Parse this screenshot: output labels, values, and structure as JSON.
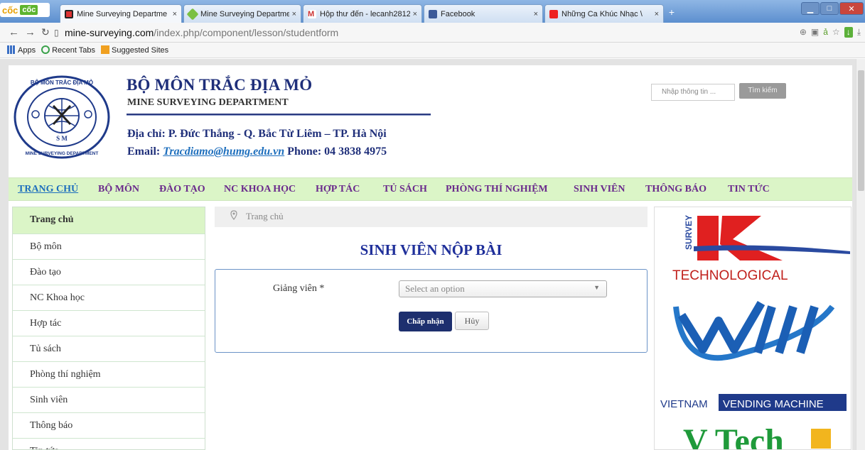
{
  "browser": {
    "brand_a": "cốc",
    "brand_b": "cốc",
    "tabs": [
      {
        "title": "Mine Surveying Departme",
        "close": "×"
      },
      {
        "title": "Mine Surveying Departme",
        "close": "×"
      },
      {
        "title": "Hộp thư đến - lecanh2812(",
        "close": "×"
      },
      {
        "title": "Facebook",
        "close": "×"
      },
      {
        "title": "Những Ca Khúc Nhạc \\",
        "close": "×"
      }
    ],
    "new_tab": "+",
    "url_host": "mine-surveying.com",
    "url_path": "/index.php/component/lesson/studentform",
    "bookmarks": [
      "Apps",
      "Recent Tabs",
      "Suggested Sites"
    ]
  },
  "header": {
    "site_name": "BỘ MÔN TRẮC ĐỊA MỎ",
    "site_subtitle": "MINE SURVEYING DEPARTMENT",
    "address": "Địa chỉ: P. Đức Thắng - Q. Bắc Từ Liêm – TP. Hà Nội",
    "email_label": "Email: ",
    "email": "Tracdiamo@humg.edu.vn",
    "phone": "  Phone: 04 3838 4975",
    "logo_text_top": "BỘ MÔN TRẮC ĐỊA MỎ",
    "logo_text_bottom": "MINE SURVEYING DEPARTMENT",
    "search_placeholder": "Nhập thông tin ...",
    "search_button": "Tìm kiếm"
  },
  "menu": [
    "TRANG CHỦ",
    "BỘ MÔN",
    "ĐÀO TẠO",
    "NC KHOA HỌC",
    "HỢP TÁC",
    "TỦ SÁCH",
    "PHÒNG THÍ NGHIỆM",
    "SINH VIÊN",
    "THÔNG BÁO",
    "TIN TỨC"
  ],
  "sidebar": [
    "Trang chủ",
    "Bộ môn",
    "Đào tạo",
    "NC Khoa học",
    "Hợp tác",
    "Tủ sách",
    "Phòng thí nghiệm",
    "Sinh viên",
    "Thông báo",
    "Tin tức"
  ],
  "main": {
    "breadcrumb": "Trang chủ",
    "title": "SINH VIÊN NỘP BÀI",
    "field_label": "Giảng viên *",
    "select_placeholder": "Select an option",
    "submit": "Chấp nhận",
    "cancel": "Hủy"
  },
  "ads": {
    "ad1_side": "SURVEY",
    "ad1_text": "TECHNOLOGICAL",
    "ad2_left": "VIETNAM",
    "ad2_right": "VENDING MACHINE",
    "ad3_text": "V  Tech"
  },
  "colors": {
    "menu_bg": "#dbf5c7",
    "title_blue": "#1f2f9a",
    "menu_purple": "#6a2a8c",
    "button_navy": "#1d2f6e"
  }
}
